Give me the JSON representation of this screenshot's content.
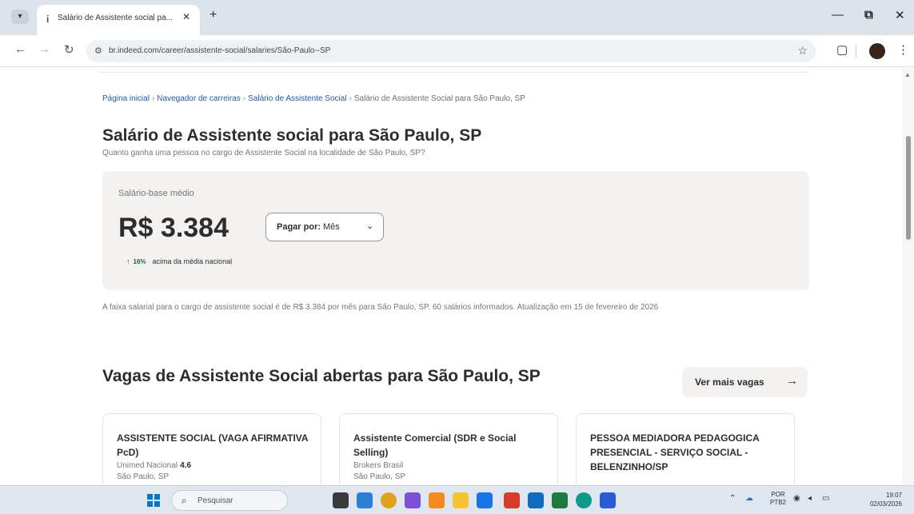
{
  "browser": {
    "tab_title": "Salário de Assistente social pa...",
    "url": "br.indeed.com/career/assistente-social/salaries/São-Paulo--SP"
  },
  "page": {
    "breadcrumb": [
      "Página inicial",
      "Navegador de carreiras",
      "Salário de Assistente Social",
      "Salário de Assistente Social para São Paulo, SP"
    ],
    "title": "Salário de Assistente social para São Paulo, SP",
    "subtitle": "Quanto ganha uma pessoa no cargo de Assistente Social na localidade de São Paulo, SP?",
    "salary": {
      "label": "Salário-base médio",
      "value": "R$ 3.384",
      "pay_by_label": "Pagar por:",
      "pay_by_value": "Mês",
      "compare_pct": "16%",
      "compare_text": "acima da média nacional"
    },
    "description": "A faixa salarial para o cargo de assistente social é de R$ 3.384 por mês para São Paulo, SP. 60 salários informados. Atualização em 15 de fevereiro de 2026",
    "jobs": {
      "title": "Vagas de Assistente Social abertas para São Paulo, SP",
      "more_button": "Ver mais vagas",
      "cards": [
        {
          "title": "ASSISTENTE SOCIAL (VAGA AFIRMATIVA PcD)",
          "company": "Unimed Nacional",
          "rating": "4.6",
          "location": "São Paulo, SP"
        },
        {
          "title": "Assistente Comercial (SDR e Social Selling)",
          "company": "Brokers Brasil",
          "rating": "",
          "location": "São Paulo, SP"
        },
        {
          "title": "PESSOA MEDIADORA PEDAGOGICA PRESENCIAL - SERVIÇO SOCIAL - BELENZINHO/SP",
          "company": "",
          "rating": "",
          "location": ""
        }
      ]
    }
  },
  "taskbar": {
    "search_placeholder": "Pesquisar",
    "lang_top": "POR",
    "lang_bottom": "PTB2",
    "time": "19:07",
    "date": "02/03/2026"
  }
}
